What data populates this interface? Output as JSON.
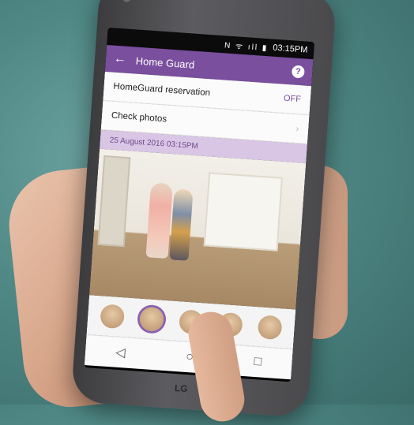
{
  "status_bar": {
    "icons": "N ᯤ ıll ▮",
    "time": "03:15PM"
  },
  "app_bar": {
    "title": "Home Guard",
    "back_icon": "arrow-left-icon",
    "help_label": "?"
  },
  "settings": [
    {
      "label": "HomeGuard reservation",
      "value": "OFF"
    },
    {
      "label": "Check photos",
      "value": "›"
    }
  ],
  "photo_date": "25 August 2016 03:15PM",
  "thumbnails": [
    "photo-1",
    "photo-2",
    "photo-3",
    "photo-4",
    "photo-5"
  ],
  "selected_thumbnail_index": 1,
  "nav": {
    "back": "◁",
    "home": "○",
    "recents": "□"
  },
  "brand": "LG"
}
